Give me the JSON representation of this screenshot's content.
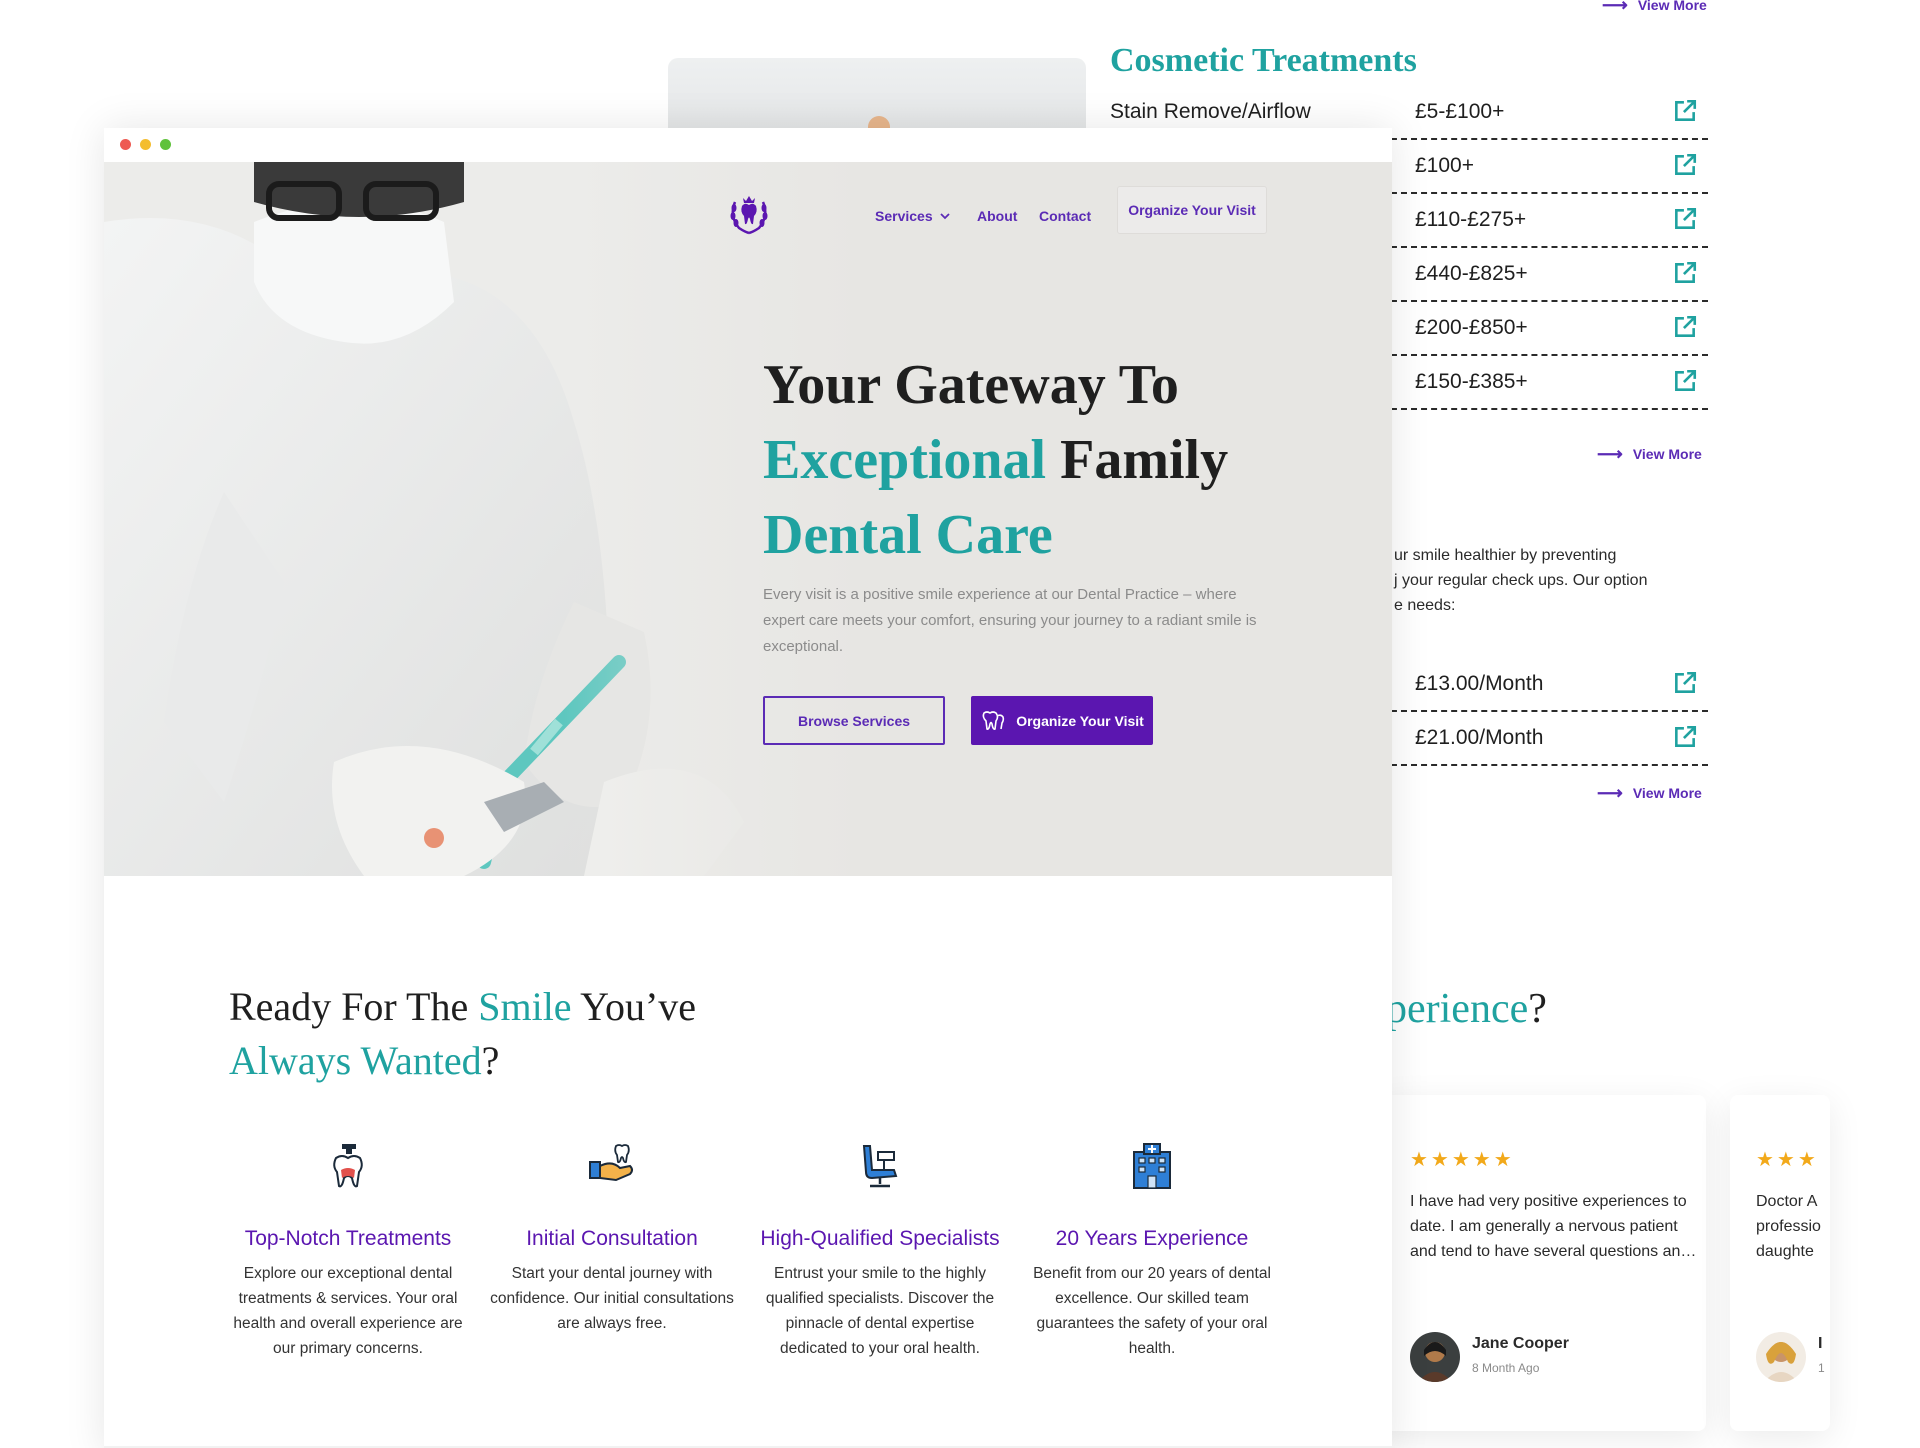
{
  "background_page": {
    "view_more_label": "View More",
    "cosmetic_title": "Cosmetic Treatments",
    "price_rows": [
      {
        "name": "Stain Remove/Airflow",
        "price": "£5-£100+"
      },
      {
        "name": "",
        "price": "£100+"
      },
      {
        "name": "",
        "price": "£110-£275+"
      },
      {
        "name": "",
        "price": "£440-£825+"
      },
      {
        "name": "",
        "price": "£200-£850+"
      },
      {
        "name": "",
        "price": "£150-£385+"
      }
    ],
    "plan_text_lines": [
      "ur smile healthier by preventing",
      "j your regular check ups. Our option",
      "e needs:"
    ],
    "plan_rows": [
      {
        "price": "£13.00/Month"
      },
      {
        "price": "£21.00/Month"
      }
    ],
    "experience_heading": "perience",
    "experience_heading_mark": "?",
    "reviews": [
      {
        "stars": "★★★★★",
        "text": "I have had very positive experiences to date. I am generally a nervous patient and tend to have several questions an…",
        "name": "Jane Cooper",
        "date": "8 Month Ago"
      },
      {
        "stars": "★★★",
        "text_lines": [
          "Doctor A",
          "professio",
          "daughte"
        ],
        "name": "I",
        "date": "1"
      }
    ]
  },
  "nav": {
    "items": [
      "Services",
      "About",
      "Contact"
    ],
    "cta": "Organize Your Visit"
  },
  "hero": {
    "title_part1": "Your Gateway To",
    "title_part2_teal": "Exceptional",
    "title_part3": " Family",
    "title_part4_teal": "Dental Care",
    "description": "Every visit is a positive smile experience at our Dental Practice – where expert care meets your comfort, ensuring your journey to a radiant smile is exceptional.",
    "btn_browse": "Browse Services",
    "btn_organize": "Organize Your Visit"
  },
  "features": {
    "heading_part1": "Ready For The ",
    "heading_smile": "Smile",
    "heading_part2": " You’ve",
    "heading_always": "Always Wanted",
    "heading_mark": "?",
    "items": [
      {
        "icon": "tooth-drill-icon",
        "title": "Top-Notch Treatments",
        "desc": "Explore our exceptional dental treatments & services. Your oral health and overall experience are our primary concerns."
      },
      {
        "icon": "hand-tooth-icon",
        "title": "Initial Consultation",
        "desc": "Start your dental journey with confidence. Our initial consultations are always free."
      },
      {
        "icon": "dental-chair-icon",
        "title": "High-Qualified Specialists",
        "desc": "Entrust your smile to the highly qualified specialists. Discover the pinnacle of dental expertise dedicated to your oral health."
      },
      {
        "icon": "hospital-icon",
        "title": "20 Years Experience",
        "desc": "Benefit from our 20 years of dental excellence. Our skilled team guarantees the safety of your oral health."
      }
    ]
  },
  "colors": {
    "purple": "#5b16b0",
    "teal": "#1fa2a0",
    "hero_bg": "#e7e6e3",
    "star": "#f2a91a"
  }
}
